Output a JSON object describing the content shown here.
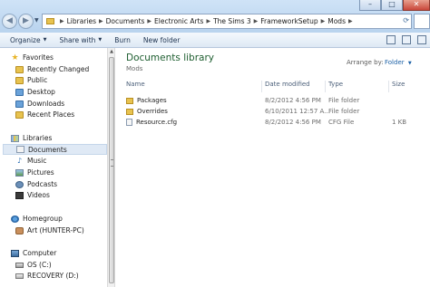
{
  "window": {
    "controls": {
      "minimize": "–",
      "maximize": "□",
      "close": "✕"
    }
  },
  "address": {
    "crumbs": [
      "Libraries",
      "Documents",
      "Electronic Arts",
      "The Sims 3",
      "FrameworkSetup",
      "Mods"
    ]
  },
  "toolbar": {
    "organize": "Organize",
    "share_with": "Share with",
    "burn": "Burn",
    "new_folder": "New folder"
  },
  "navpane": {
    "favorites": {
      "header": "Favorites",
      "items": [
        "Recently Changed",
        "Public",
        "Desktop",
        "Downloads",
        "Recent Places"
      ]
    },
    "libraries": {
      "header": "Libraries",
      "items": [
        "Documents",
        "Music",
        "Pictures",
        "Podcasts",
        "Videos"
      ]
    },
    "homegroup": {
      "header": "Homegroup",
      "items": [
        "Art (HUNTER-PC)"
      ]
    },
    "computer": {
      "header": "Computer",
      "items": [
        "OS (C:)",
        "RECOVERY (D:)"
      ]
    }
  },
  "content": {
    "title": "Documents library",
    "subtitle": "Mods",
    "arrange_label": "Arrange by:",
    "arrange_value": "Folder",
    "columns": {
      "name": "Name",
      "date": "Date modified",
      "type": "Type",
      "size": "Size"
    },
    "files": [
      {
        "name": "Packages",
        "date": "8/2/2012 4:56 PM",
        "type": "File folder",
        "size": "",
        "icon": "folder-icon"
      },
      {
        "name": "Overrides",
        "date": "6/10/2011 12:57 A...",
        "type": "File folder",
        "size": "",
        "icon": "folder-icon"
      },
      {
        "name": "Resource.cfg",
        "date": "8/2/2012 4:56 PM",
        "type": "CFG File",
        "size": "1 KB",
        "icon": "cfg-file-icon"
      }
    ]
  },
  "colors": {
    "title_green": "#1e5e30",
    "link_blue": "#1a5fa5",
    "selection": "#dfe9f5"
  }
}
